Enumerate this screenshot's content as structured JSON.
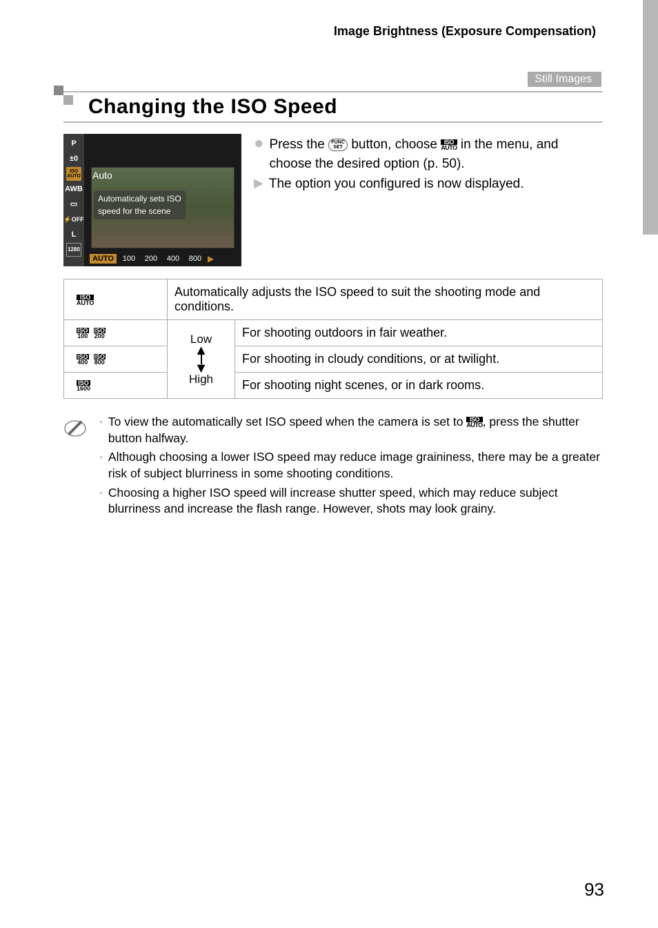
{
  "breadcrumb": "Image Brightness (Exposure Compensation)",
  "badge": "Still Images",
  "section_title": "Changing the ISO Speed",
  "camera": {
    "auto_label": "Auto",
    "tip_line1": "Automatically sets ISO",
    "tip_line2": "speed for the scene",
    "sidebar": {
      "p": "P",
      "ev": "±0",
      "awb": "AWB",
      "off": "OFF",
      "l": "L",
      "res": "1280"
    },
    "bottom": {
      "auto": "AUTO",
      "v1": "100",
      "v2": "200",
      "v3": "400",
      "v4": "800"
    }
  },
  "instructions": {
    "line1a": "Press the ",
    "func": "FUNC\nSET",
    "line1b": " button, choose ",
    "line1c": " in the menu, and choose the desired option (p. 50).",
    "line2": "The option you configured is now displayed."
  },
  "iso_icons": {
    "auto_top": "ISO",
    "auto_bot": "AUTO",
    "i100": "100",
    "i200": "200",
    "i400": "400",
    "i800": "800",
    "i1600": "1600"
  },
  "table": {
    "auto_desc": "Automatically adjusts the ISO speed to suit the shooting mode and conditions.",
    "low": "Low",
    "high": "High",
    "row2_desc": "For shooting outdoors in fair weather.",
    "row3_desc": "For shooting in cloudy conditions, or at twilight.",
    "row4_desc": "For shooting night scenes, or in dark rooms."
  },
  "notes": {
    "n1a": "To view the automatically set ISO speed when the camera is set to ",
    "n1b": ", press the shutter button halfway.",
    "n2": "Although choosing a lower ISO speed may reduce image graininess, there may be a greater risk of subject blurriness in some shooting conditions.",
    "n3": "Choosing a higher ISO speed will increase shutter speed, which may reduce subject blurriness and increase the flash range. However, shots may look grainy."
  },
  "page_number": "93"
}
